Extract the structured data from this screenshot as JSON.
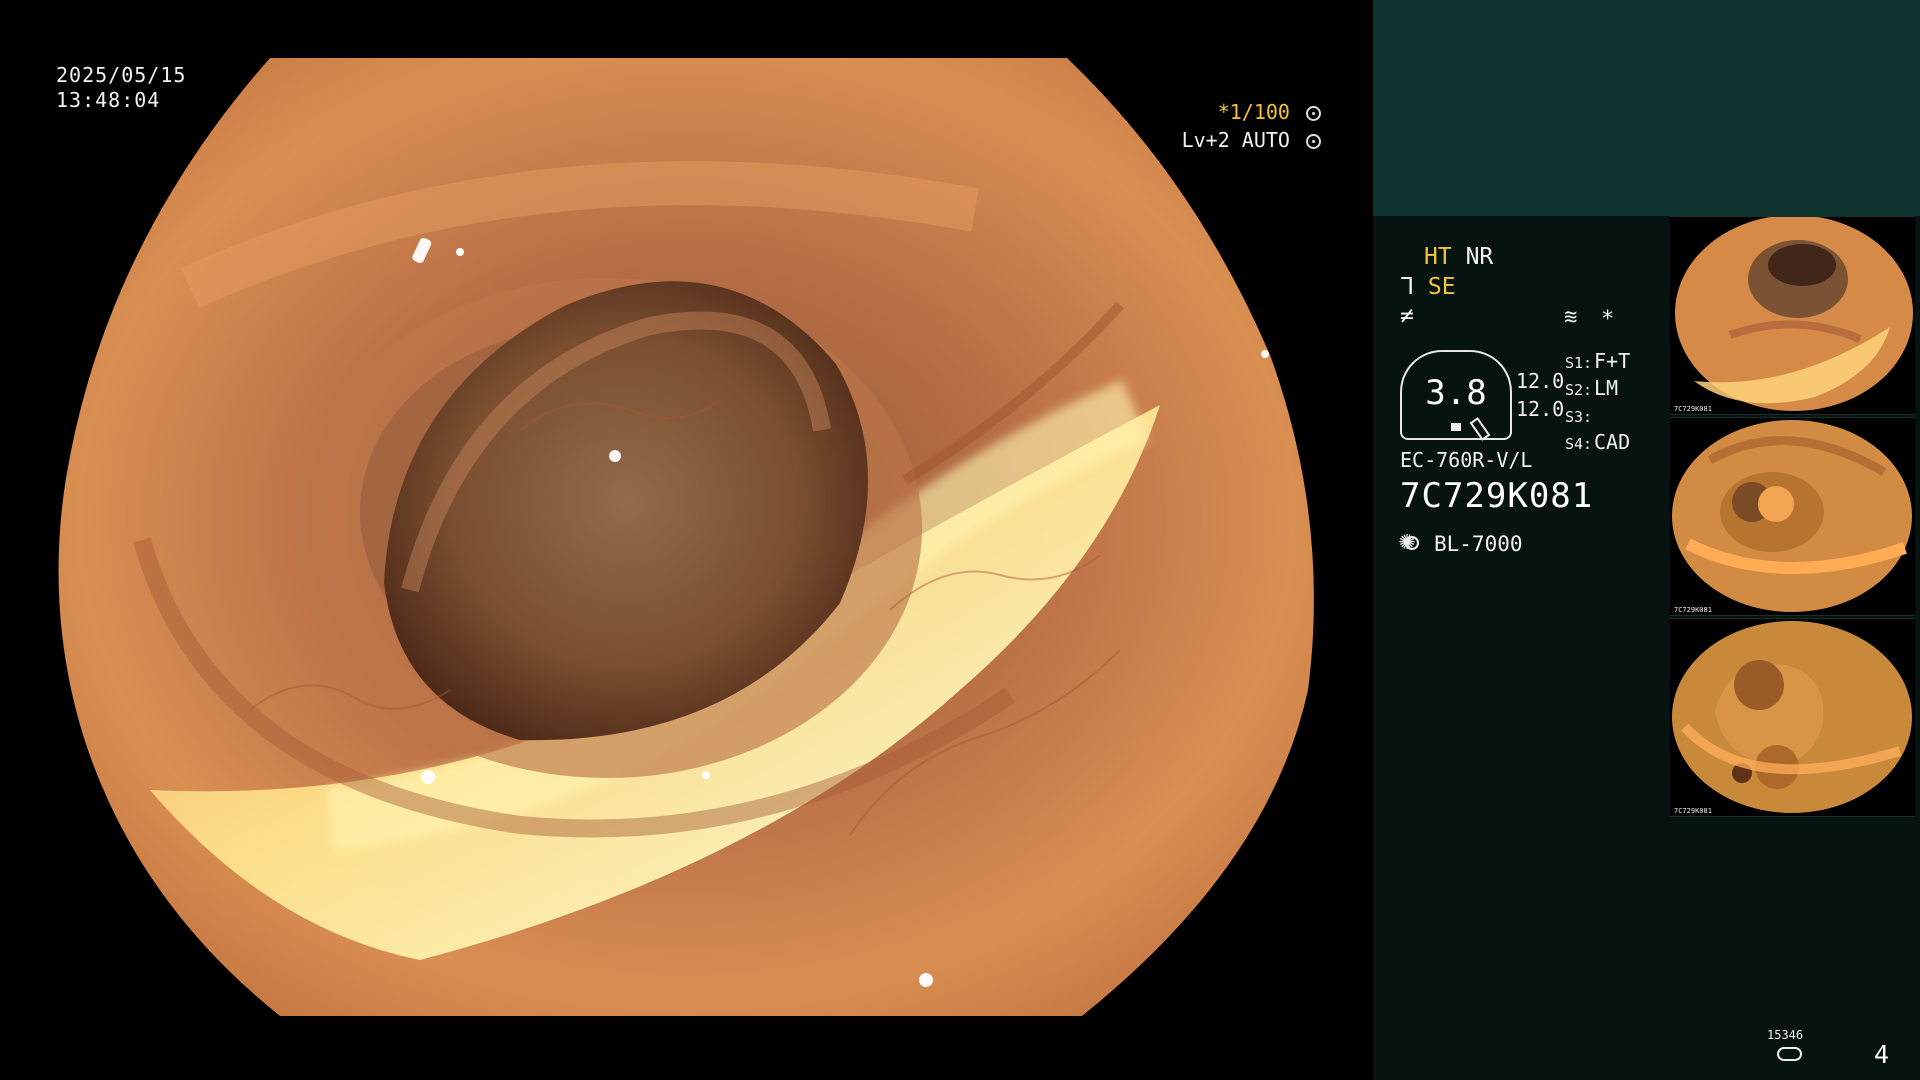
{
  "header": {
    "date": "2025/05/15",
    "time": "13:48:04",
    "shutter": "*1/100",
    "level": "Lv+2 AUTO"
  },
  "panel": {
    "status": {
      "line1_left": "HT",
      "line1_right": "NR",
      "line2_left": "ᒣ",
      "line2_right": "SE",
      "line3_icon": "≠",
      "right_icons": [
        "≋",
        "*"
      ]
    },
    "gauge": {
      "value": "3.8",
      "levels": [
        "12.0",
        "12.0"
      ]
    },
    "settings": [
      {
        "key": "S1:",
        "value": "F+T"
      },
      {
        "key": "S2:",
        "value": "LM"
      },
      {
        "key": "S3:",
        "value": ""
      },
      {
        "key": "S4:",
        "value": "CAD"
      }
    ],
    "scope_model": "EC-760R-V/L",
    "serial": "7C729K081",
    "lamp": "BL-7000",
    "counter": "15346",
    "page_number": "4"
  },
  "colors": {
    "background": "#000000",
    "panel_bg": "#071311",
    "panel_header_bg": "#103531",
    "yellow_text": "#f0c43b",
    "tissue_orange": "#d98f46",
    "highlight_yellow": "#fff4a8"
  },
  "icons": {
    "image_mode": "settings-gear-icon",
    "auto_mode": "auto-exposure-icon",
    "lamp": "sun-lamp-icon",
    "counter": "disk-counter-icon"
  },
  "thumbnails": [
    {
      "caption": "7C729K081"
    },
    {
      "caption": "7C729K081"
    },
    {
      "caption": "7C729K081"
    }
  ]
}
